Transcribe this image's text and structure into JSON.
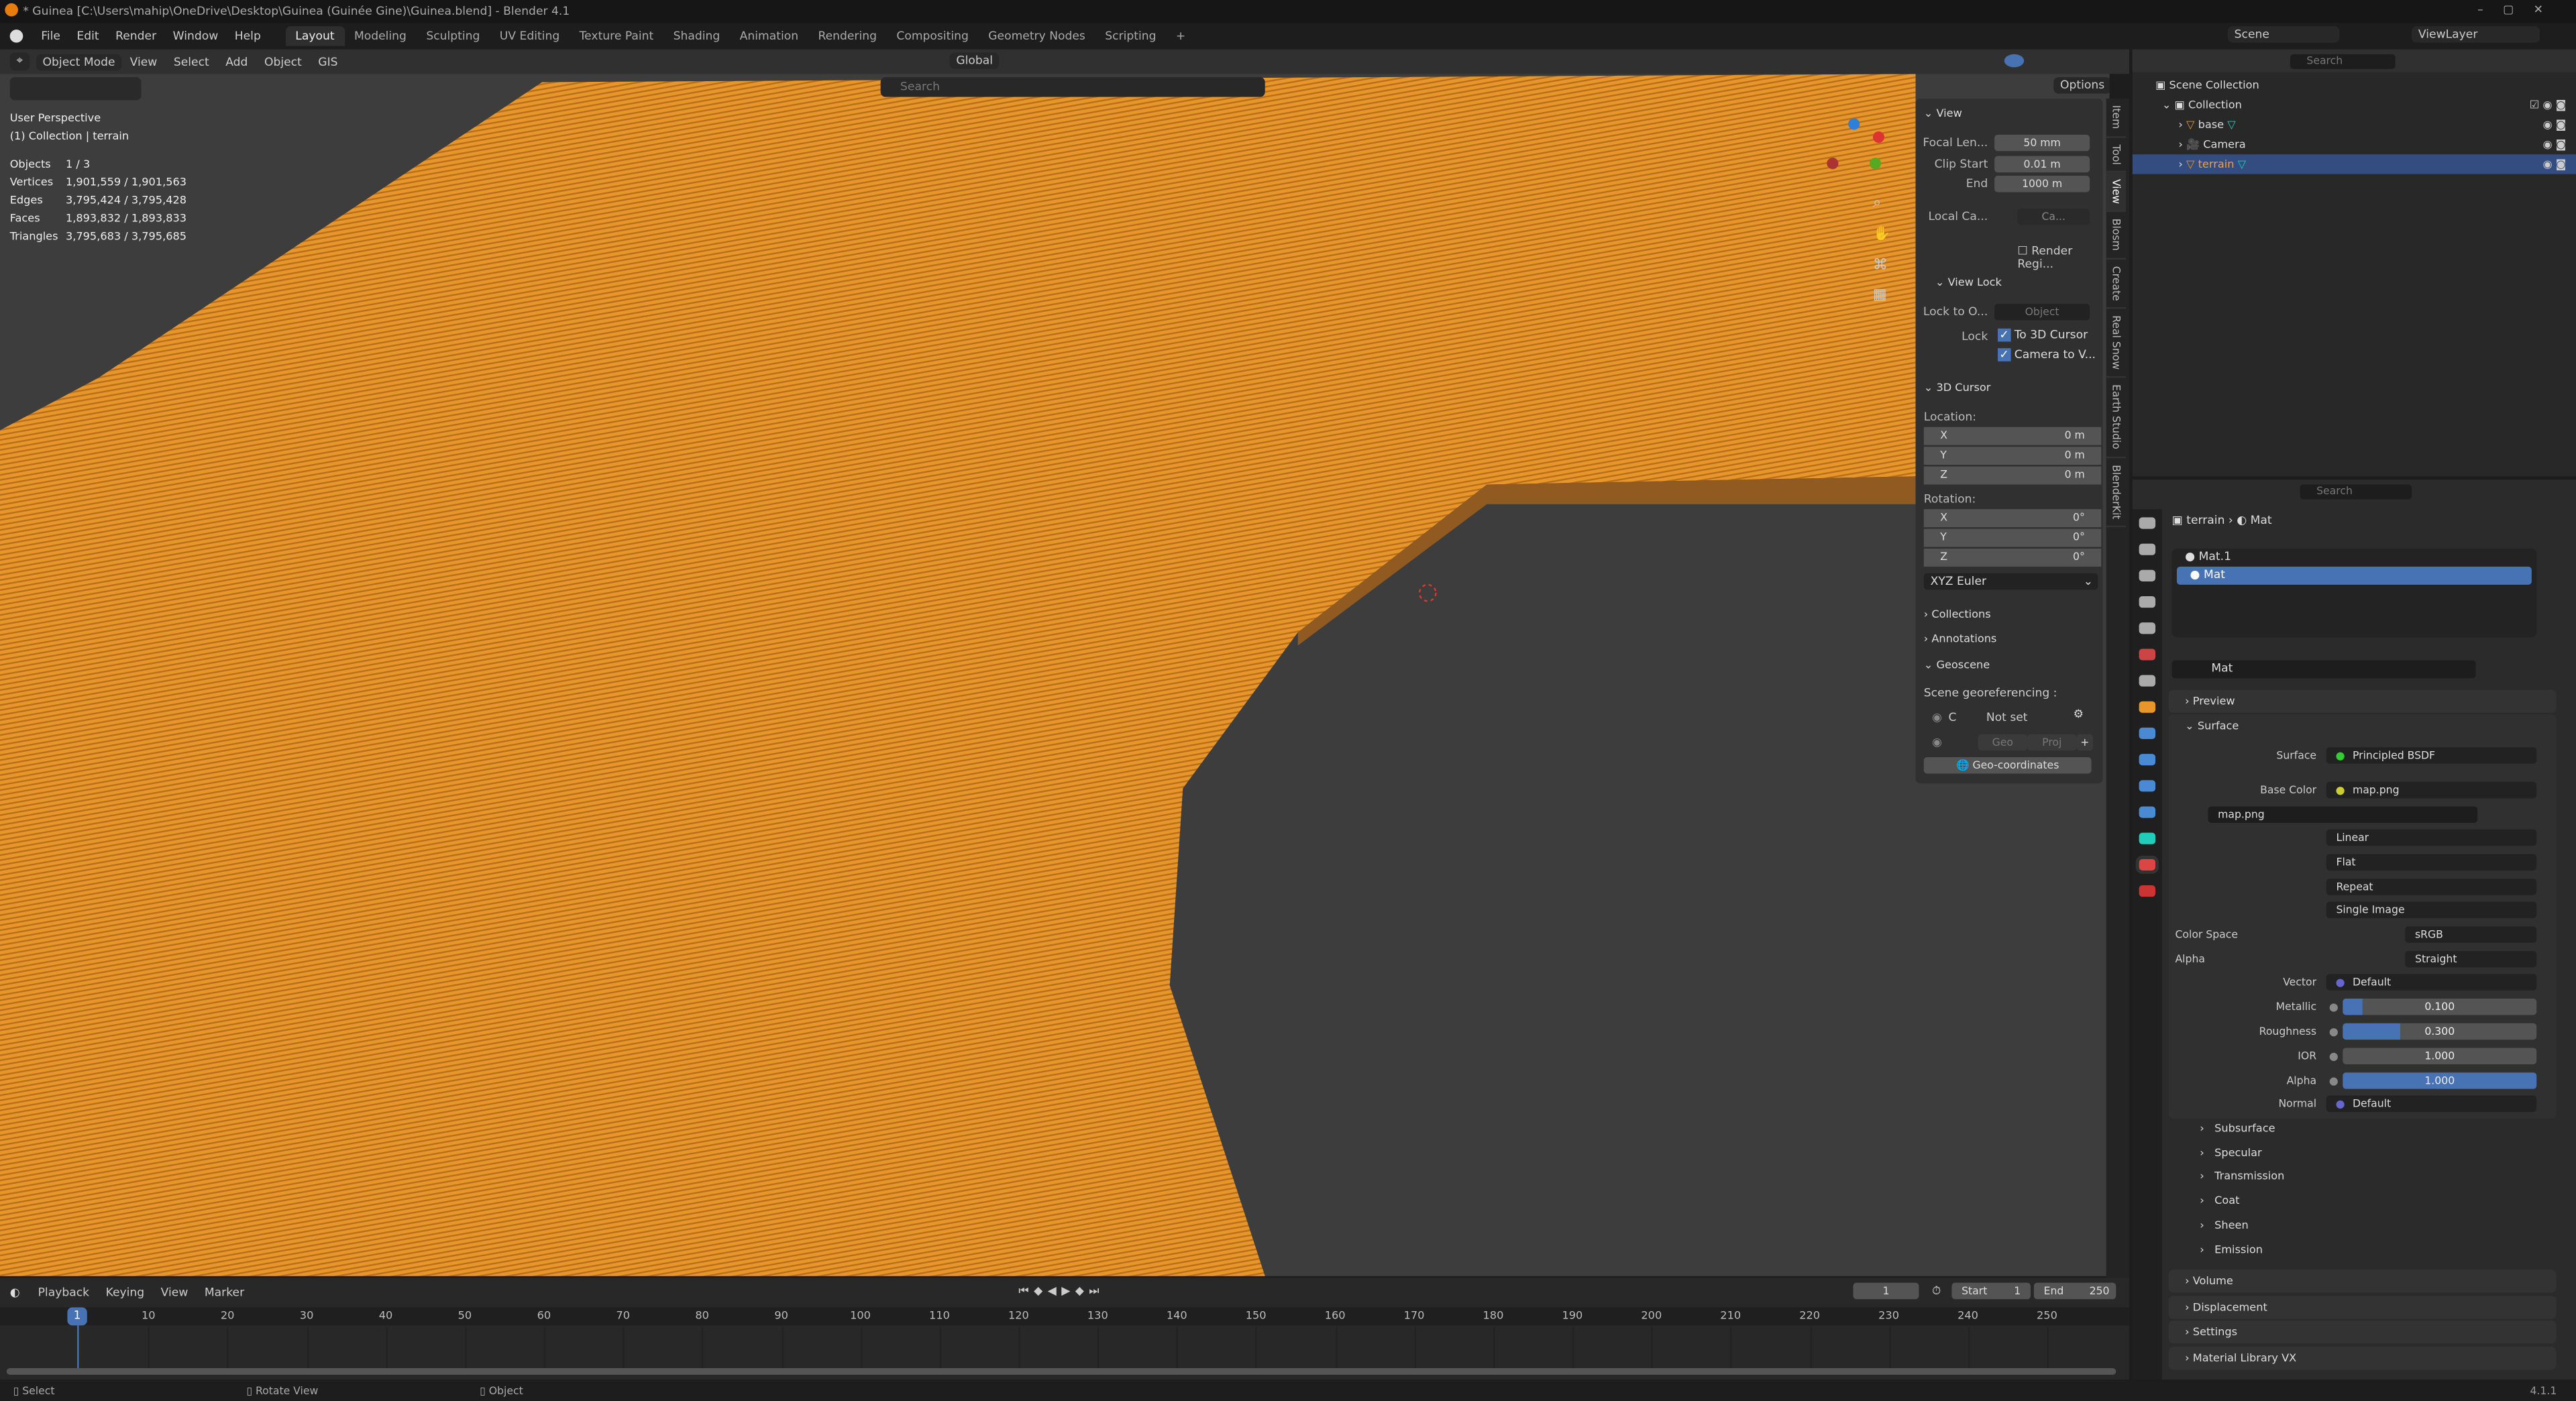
{
  "window": {
    "title": "* Guinea [C:\\Users\\mahip\\OneDrive\\Desktop\\Guinea (Guinée  Gine)\\Guinea.blend] - Blender 4.1"
  },
  "menu": [
    "File",
    "Edit",
    "Render",
    "Window",
    "Help"
  ],
  "workspaces": [
    "Layout",
    "Modeling",
    "Sculpting",
    "UV Editing",
    "Texture Paint",
    "Shading",
    "Animation",
    "Rendering",
    "Compositing",
    "Geometry Nodes",
    "Scripting",
    "+"
  ],
  "scene": {
    "label": "Scene",
    "view_layer": "ViewLayer"
  },
  "viewport_header": {
    "mode": "Object Mode",
    "menus": [
      "View",
      "Select",
      "Add",
      "Object",
      "GIS"
    ],
    "orientation": "Global",
    "search_placeholder": "Search",
    "options": "Options"
  },
  "overlay": {
    "perspective": "User Perspective",
    "collection": "(1) Collection | terrain",
    "stats": [
      {
        "k": "Objects",
        "v": "1 / 3"
      },
      {
        "k": "Vertices",
        "v": "1,901,559 / 1,901,563"
      },
      {
        "k": "Edges",
        "v": "3,795,424 / 3,795,428"
      },
      {
        "k": "Faces",
        "v": "1,893,832 / 1,893,833"
      },
      {
        "k": "Triangles",
        "v": "3,795,683 / 3,795,685"
      }
    ]
  },
  "npanel": {
    "view_title": "View",
    "focal_label": "Focal Len...",
    "focal": "50 mm",
    "clip_start_label": "Clip Start",
    "clip_start": "0.01 m",
    "end_label": "End",
    "end": "1000 m",
    "local_cam_label": "Local Ca...",
    "local_cam": "Ca...",
    "render_region": "Render Regi...",
    "view_lock": "View Lock",
    "lock_to_label": "Lock to O...",
    "lock_to_placeholder": "Object",
    "lock_label": "Lock",
    "to_cursor": "To 3D Cursor",
    "cam_to_view": "Camera to V...",
    "cursor_title": "3D Cursor",
    "location": "Location:",
    "rotation": "Rotation:",
    "loc": [
      {
        "a": "X",
        "v": "0 m"
      },
      {
        "a": "Y",
        "v": "0 m"
      },
      {
        "a": "Z",
        "v": "0 m"
      }
    ],
    "rot": [
      {
        "a": "X",
        "v": "0°"
      },
      {
        "a": "Y",
        "v": "0°"
      },
      {
        "a": "Z",
        "v": "0°"
      }
    ],
    "rot_mode": "XYZ Euler",
    "collections": "Collections",
    "annotations": "Annotations",
    "geoscene": "Geoscene",
    "georef": "Scene georeferencing :",
    "crs_c": "C",
    "not_set": "Not set",
    "geo": "Geo",
    "proj": "Proj",
    "geocoords": "Geo-coordinates"
  },
  "side_tabs": [
    "Item",
    "Tool",
    "View",
    "Blosm",
    "Create",
    "Real Snow",
    "Earth Studio",
    "BlenderKit"
  ],
  "outliner": {
    "search_placeholder": "Search",
    "root": "Scene Collection",
    "collection": "Collection",
    "items": [
      {
        "name": "base"
      },
      {
        "name": "Camera"
      },
      {
        "name": "terrain"
      }
    ]
  },
  "properties": {
    "search_placeholder": "Search",
    "breadcrumb_obj": "terrain",
    "breadcrumb_mat": "Mat",
    "slots": [
      "Mat.1",
      "Mat"
    ],
    "material": "Mat",
    "preview": "Preview",
    "surface_sec": "Surface",
    "surface_label": "Surface",
    "surface_val": "Principled BSDF",
    "base_color_label": "Base Color",
    "base_color_val": "map.png",
    "image": "map.png",
    "interp": "Linear",
    "projection": "Flat",
    "extension": "Repeat",
    "source": "Single Image",
    "color_space_label": "Color Space",
    "color_space": "sRGB",
    "alpha_mode_label": "Alpha",
    "alpha_mode": "Straight",
    "vector_label": "Vector",
    "vector": "Default",
    "sliders": [
      {
        "label": "Metallic",
        "text": "0.100",
        "value": 0.1
      },
      {
        "label": "Roughness",
        "text": "0.300",
        "value": 0.3
      },
      {
        "label": "IOR",
        "text": "1.000",
        "value": 0
      },
      {
        "label": "Alpha",
        "text": "1.000",
        "value": 1.0
      }
    ],
    "normal_label": "Normal",
    "normal": "Default",
    "subpanels": [
      "Subsurface",
      "Specular",
      "Transmission",
      "Coat",
      "Sheen",
      "Emission"
    ],
    "sections": [
      "Volume",
      "Displacement",
      "Settings",
      "Material Library VX"
    ],
    "version": "4.1.1"
  },
  "timeline": {
    "menus": [
      "Playback",
      "Keying",
      "View",
      "Marker"
    ],
    "current": "1",
    "start_label": "Start",
    "start": "1",
    "end_label": "End",
    "end": "250",
    "ticks": [
      "10",
      "20",
      "30",
      "40",
      "50",
      "60",
      "70",
      "80",
      "90",
      "100",
      "110",
      "120",
      "130",
      "140",
      "150",
      "160",
      "170",
      "180",
      "190",
      "200",
      "210",
      "220",
      "230",
      "240",
      "250"
    ]
  },
  "status": {
    "select": "Select",
    "rotate": "Rotate View",
    "object": "Object"
  },
  "colors": {
    "terrain": "#e8962a",
    "accent": "#4772b3",
    "bg": "#3d3d3d"
  }
}
